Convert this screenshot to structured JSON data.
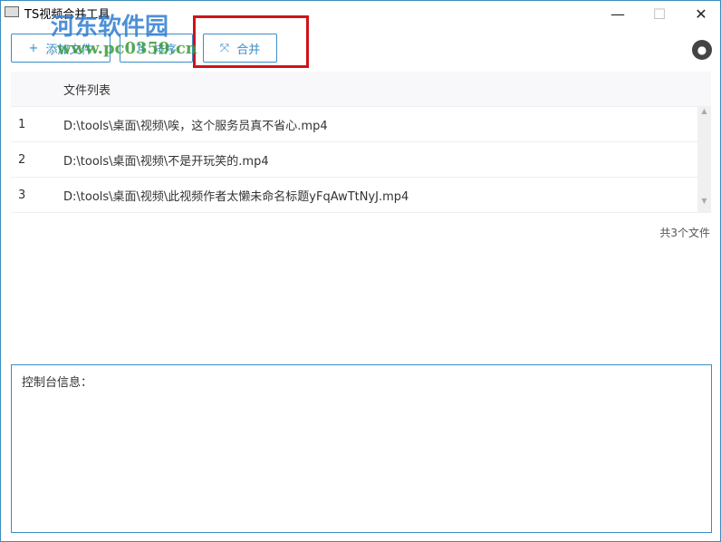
{
  "window": {
    "title": "TS视频合并工具",
    "minimize": "—",
    "maximize": "☐",
    "close": "✕"
  },
  "toolbar": {
    "add_label": "添加文件",
    "sort_label": "排序",
    "merge_label": "合并"
  },
  "table": {
    "header": "文件列表",
    "rows": [
      {
        "index": "1",
        "path": "D:\\tools\\桌面\\视频\\唉，这个服务员真不省心.mp4"
      },
      {
        "index": "2",
        "path": "D:\\tools\\桌面\\视频\\不是开玩笑的.mp4"
      },
      {
        "index": "3",
        "path": "D:\\tools\\桌面\\视频\\此视频作者太懒未命名标题yFqAwTtNyJ.mp4"
      }
    ]
  },
  "count": "共3个文件",
  "console": {
    "label": "控制台信息："
  },
  "watermark": {
    "name": "河东软件园",
    "url": "www.pc0359.cn"
  }
}
